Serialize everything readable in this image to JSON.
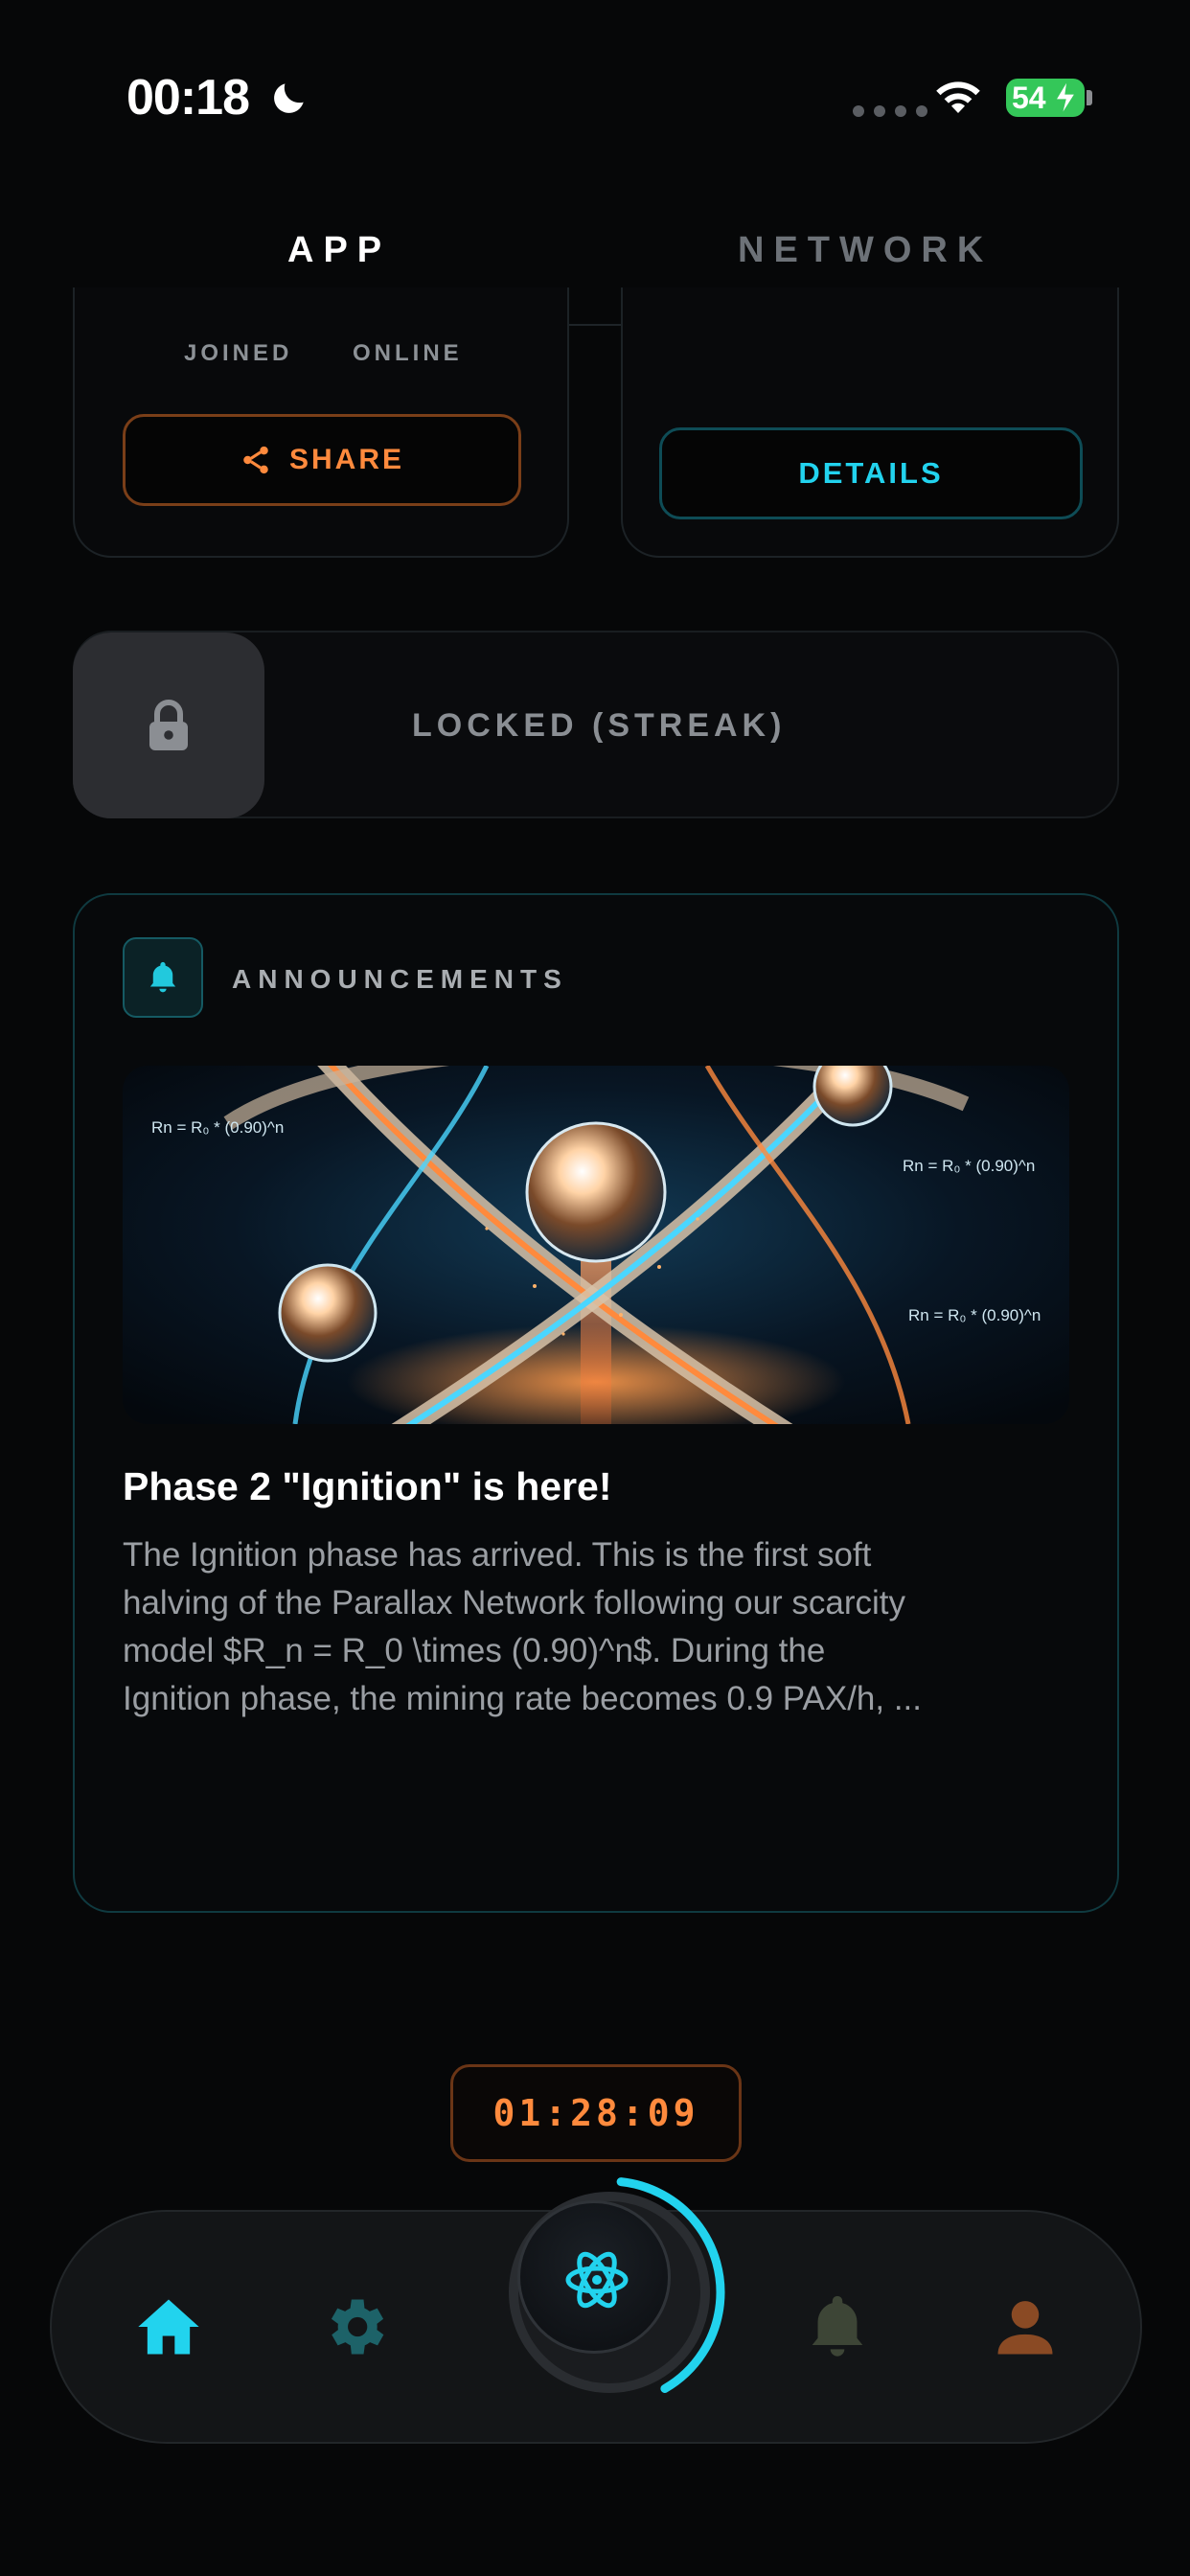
{
  "status_bar": {
    "time": "00:18",
    "battery": "54",
    "icons": [
      "moon-icon",
      "signal-dots-icon",
      "wifi-icon",
      "battery-charging-icon"
    ]
  },
  "tabs": [
    {
      "label": "APP",
      "active": true
    },
    {
      "label": "NETWORK",
      "active": false
    }
  ],
  "stats_card": {
    "joined_label": "JOINED",
    "online_label": "ONLINE",
    "share_label": "SHARE"
  },
  "details_card": {
    "details_label": "DETAILS"
  },
  "streak": {
    "label": "LOCKED (STREAK)",
    "icon": "lock-icon"
  },
  "announcements": {
    "section_title": "ANNOUNCEMENTS",
    "headline": "Phase 2 \"Ignition\" is here!",
    "body_lines": [
      "The Ignition phase has arrived. This is the first soft",
      "halving of the Parallax Network following our scarcity",
      "model $R_n = R_0 \\times (0.90)^n$. During the",
      "Ignition phase, the mining rate becomes 0.9 PAX/h, ..."
    ],
    "image_formulas": {
      "left": "Rn = R₀ * (0.90)^n",
      "right_top": "Rn = R₀ * (0.90)^n",
      "right_mid": "Rn = R₀ * (0.90)^n"
    }
  },
  "timer": {
    "value": "01:28:09"
  },
  "nav": {
    "items": [
      {
        "name": "home",
        "icon": "home-icon",
        "active": true
      },
      {
        "name": "settings",
        "icon": "gear-icon"
      },
      {
        "name": "mine",
        "icon": "atom-icon"
      },
      {
        "name": "notifications",
        "icon": "bell-icon"
      },
      {
        "name": "profile",
        "icon": "user-icon"
      }
    ],
    "mining_progress": 0.4
  },
  "colors": {
    "accent_cyan": "#22d3ee",
    "accent_orange": "#ff8a3d",
    "background": "#060708"
  }
}
